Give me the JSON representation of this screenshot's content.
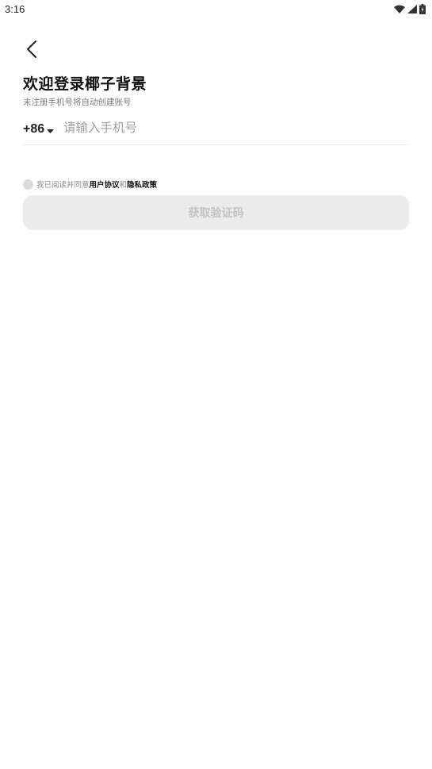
{
  "status_bar": {
    "time": "3:16",
    "icons": [
      "wifi-icon",
      "signal-icon",
      "battery-icon"
    ]
  },
  "header": {
    "back_icon": "back-arrow-icon"
  },
  "login": {
    "title": "欢迎登录椰子背景",
    "subtitle": "未注册手机号将自动创建账号",
    "country_code": "+86",
    "phone_placeholder": "请输入手机号",
    "phone_value": ""
  },
  "agreement": {
    "prefix": "我已阅读并同意",
    "user_agreement": "用户协议",
    "joiner": "和",
    "privacy_policy": "隐私政策",
    "checked": false
  },
  "actions": {
    "get_code_label": "获取验证码",
    "enabled": false
  },
  "colors": {
    "background": "#ffffff",
    "title": "#111111",
    "subtitle": "#777777",
    "placeholder": "#a0a0a0",
    "button_bg_disabled": "#ebebeb",
    "button_text_disabled": "#c2c2c2",
    "checkbox": "#dcdcdc"
  }
}
